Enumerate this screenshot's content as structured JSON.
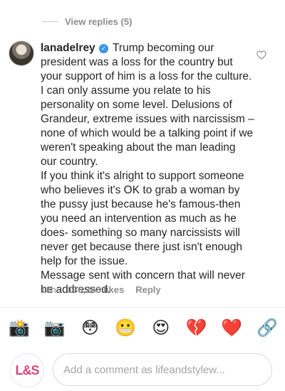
{
  "replies": {
    "label": "View replies (5)"
  },
  "comment": {
    "username": "lanadelrey",
    "verified_glyph": "✓",
    "paragraphs": [
      "Trump becoming our president was a loss for the country but your support of him is a loss for the culture.",
      "I can only assume you relate to his personality on some level. Delusions of Grandeur, extreme issues with narcissism – none of which would be a talking point if we weren't speaking about the man leading our country.",
      "If you think it's alright to support someone who believes it's OK to grab a woman by the pussy just because he's famous-then you need an intervention as much as he does- something so many narcissists will never get because there just isn't enough help for the issue.",
      "Message sent with concern that will never be addressed."
    ],
    "time": "13h",
    "likes": "136,268 likes",
    "reply_label": "Reply"
  },
  "emoji_bar": [
    {
      "name": "camera-flash-emoji",
      "glyph": "📸"
    },
    {
      "name": "camera-emoji",
      "glyph": "📷"
    },
    {
      "name": "flushed-face-emoji",
      "glyph": "😳"
    },
    {
      "name": "grimacing-face-emoji",
      "glyph": "😬"
    },
    {
      "name": "heart-eyes-emoji",
      "glyph": "😍"
    },
    {
      "name": "broken-heart-emoji",
      "glyph": "💔"
    },
    {
      "name": "red-heart-emoji",
      "glyph": "❤️"
    },
    {
      "name": "link-emoji",
      "glyph": "🔗"
    }
  ],
  "composer": {
    "logo_text": "L&S",
    "placeholder": "Add a comment as lifeandstylew..."
  },
  "colors": {
    "text": "#262626",
    "muted": "#8e8e8e",
    "verified": "#3897f0",
    "logo": "#e0427a"
  }
}
